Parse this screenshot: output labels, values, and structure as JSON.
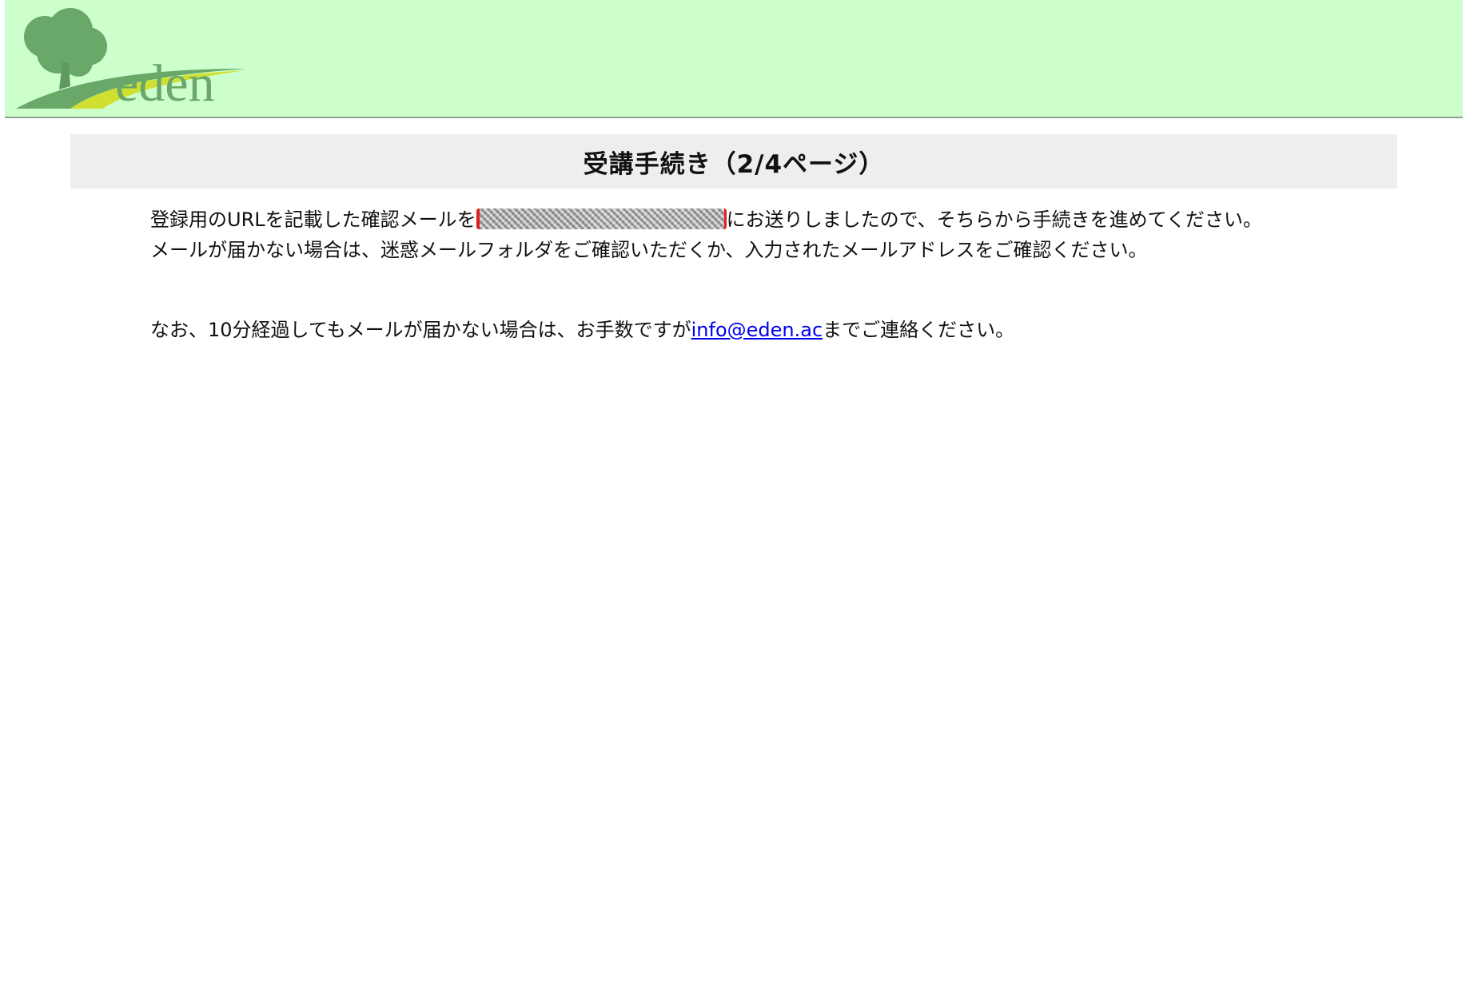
{
  "header": {
    "logo_text": "eden",
    "background": "#ccffcc",
    "logo_color": "#6aa86a",
    "swoosh_color": "#cfe030"
  },
  "main": {
    "title": "受講手続き（2/4ページ）",
    "line1_before": "登録用のURLを記載した確認メールを",
    "line1_after": "にお送りしましたので、そちらから手続きを進めてください。",
    "line2": "メールが届かない場合は、迷惑メールフォルダをご確認いただくか、入力されたメールアドレスをご確認ください。",
    "line3_before": "なお、10分経過してもメールが届かない場合は、お手数ですが",
    "contact_email": "info@eden.ac",
    "line3_after": "までご連絡ください。"
  },
  "colors": {
    "title_band": "#eeeeee",
    "link": "#0000ee",
    "redaction_border": "#e02020"
  }
}
